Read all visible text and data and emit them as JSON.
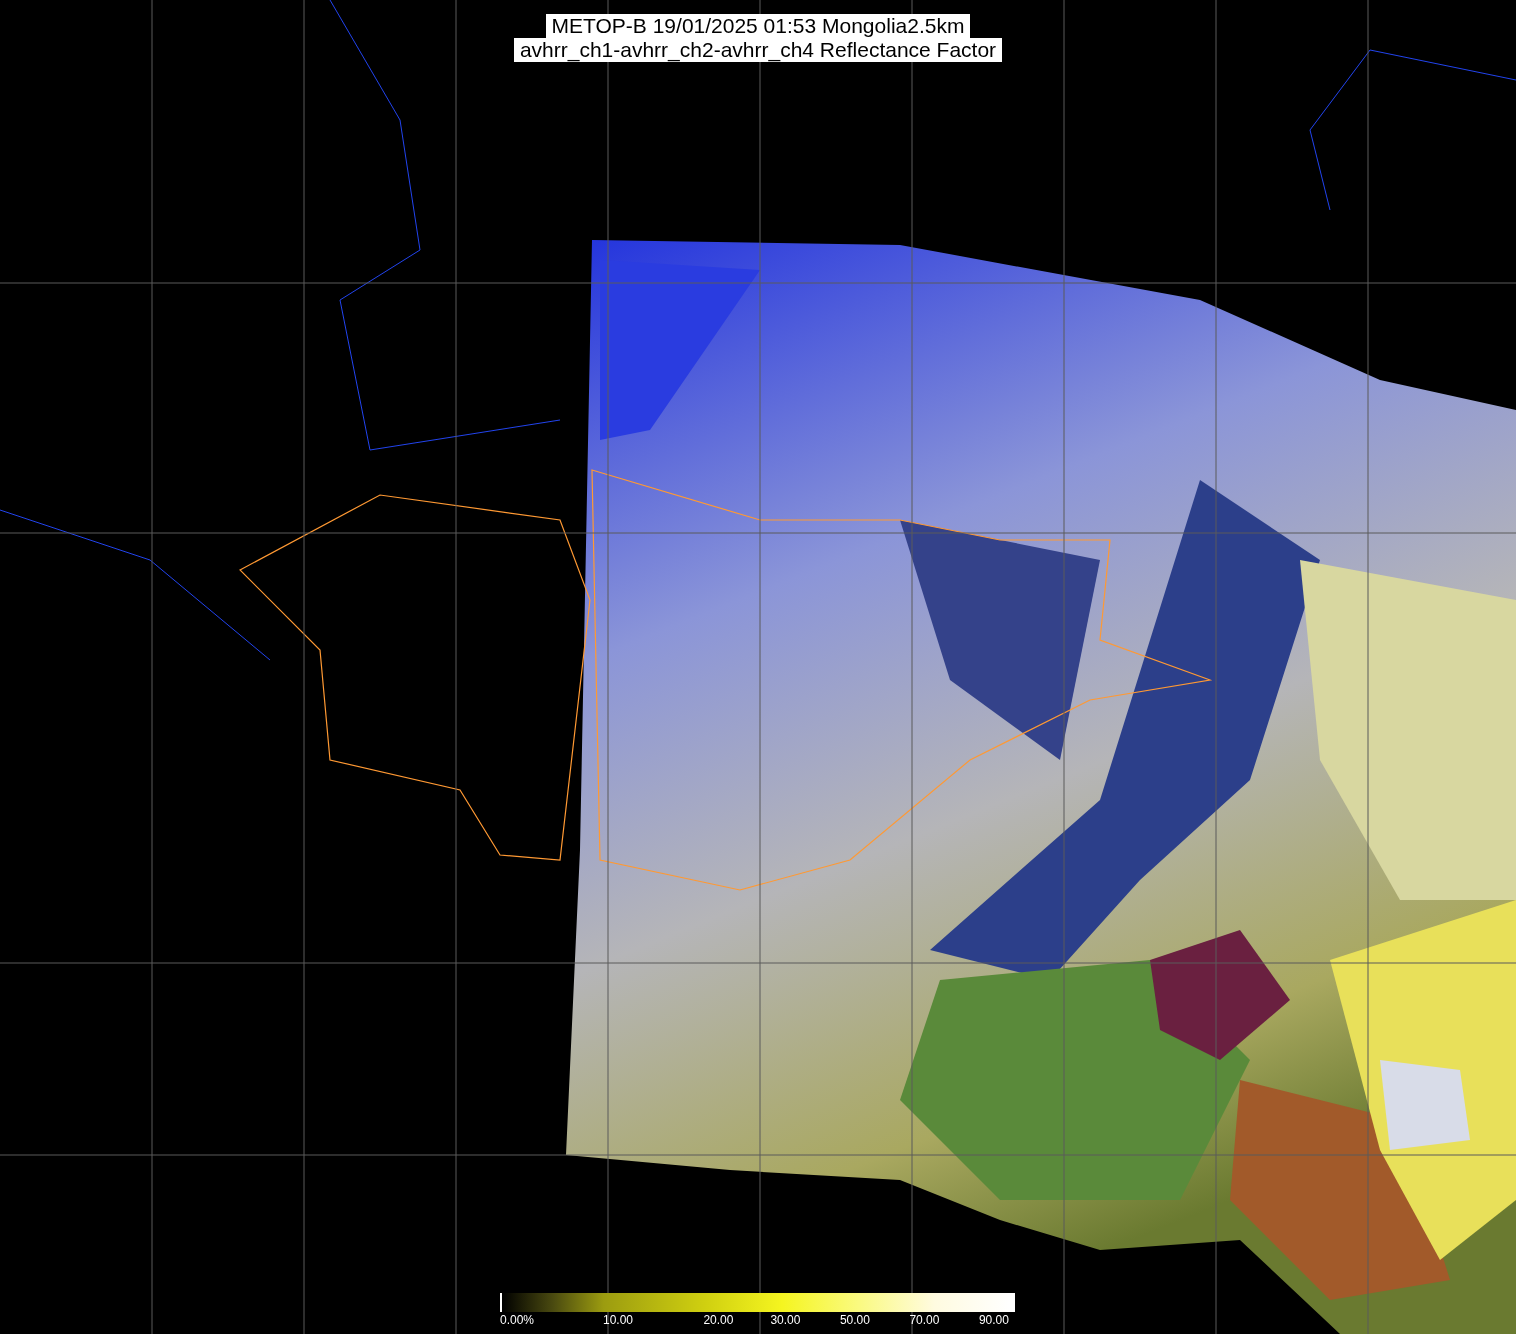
{
  "title": {
    "lines": [
      "METOP-B 19/01/2025 01:53 Mongolia2.5km",
      "avhrr_ch1-avhrr_ch2-avhrr_ch4 Reflectance Factor"
    ]
  },
  "colorbar": {
    "labels": [
      "0.00%",
      "10.00",
      "20.00",
      "30.00",
      "50.00",
      "70.00",
      "90.00"
    ]
  }
}
